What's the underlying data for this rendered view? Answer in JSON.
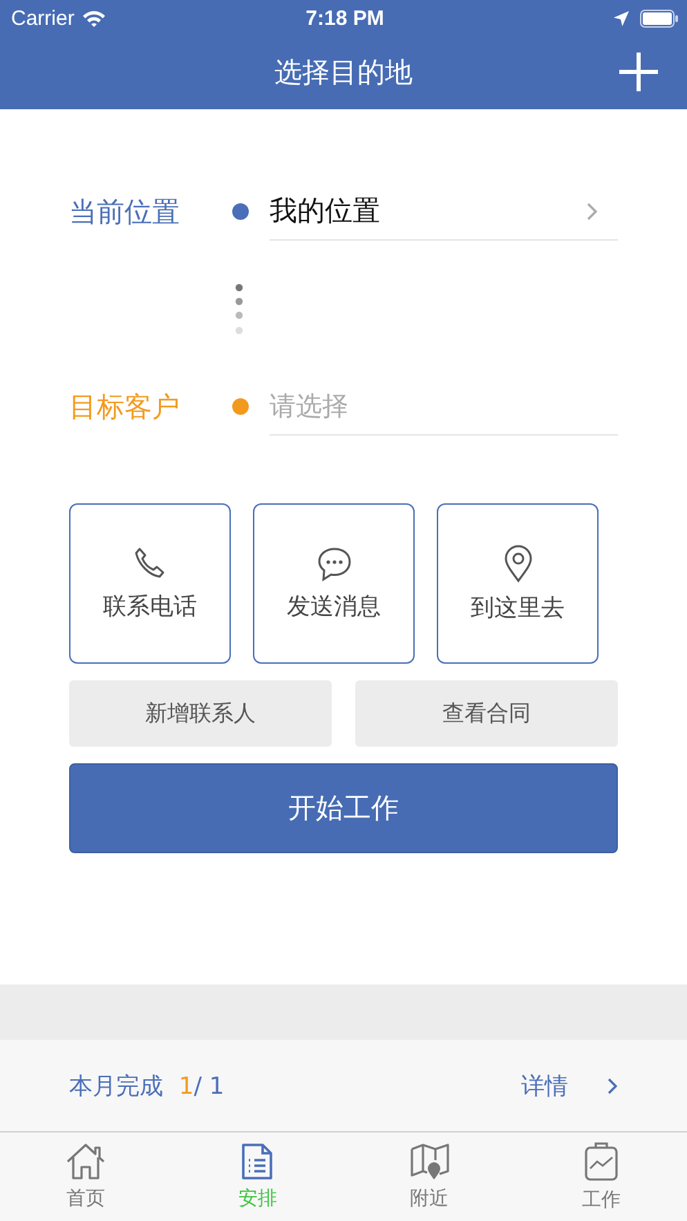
{
  "status_bar": {
    "carrier": "Carrier",
    "time": "7:18 PM"
  },
  "nav": {
    "title": "选择目的地"
  },
  "route": [
    {
      "label": "当前位置",
      "color": "#4a6fb8",
      "value": "我的位置"
    },
    {
      "label": "目标客户",
      "color": "#f39a1e",
      "placeholder": "请选择"
    }
  ],
  "actions": [
    "联系电话",
    "发送消息",
    "到这里去"
  ],
  "secondary_buttons": [
    "新增联系人",
    "查看合同"
  ],
  "primary_button": "开始工作",
  "summary": {
    "label": "本月完成",
    "done": "1",
    "total": "/ 1",
    "details": "详情"
  },
  "tabs": [
    {
      "label": "首页",
      "selected": false
    },
    {
      "label": "安排",
      "selected": true
    },
    {
      "label": "附近",
      "selected": false
    },
    {
      "label": "工作",
      "selected": false
    }
  ]
}
